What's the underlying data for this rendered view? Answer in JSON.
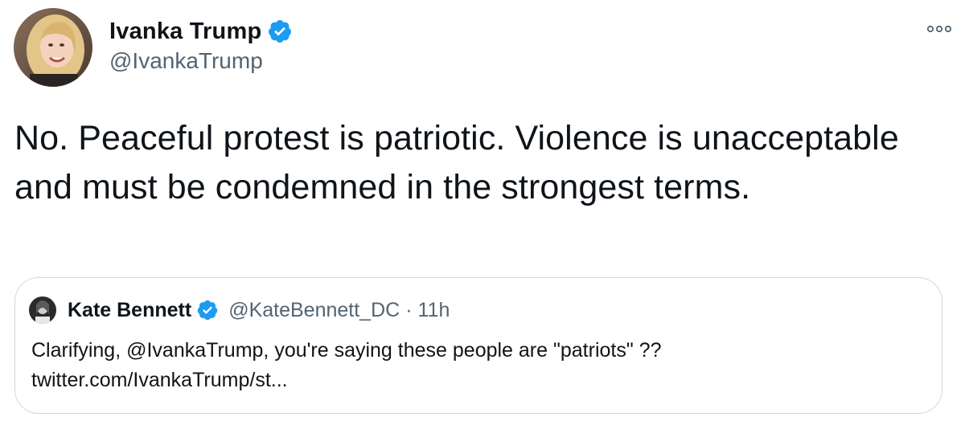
{
  "author": {
    "name": "Ivanka Trump",
    "handle": "@IvankaTrump",
    "verified": true
  },
  "tweet": {
    "text": "No. Peaceful protest is patriotic. Violence is unacceptable and must be condemned in the strongest terms."
  },
  "quoted_tweet": {
    "name": "Kate Bennett",
    "handle": "@KateBennett_DC",
    "separator": "·",
    "time": "11h",
    "text_line1": "Clarifying, @IvankaTrump, you're saying these people are \"patriots\" ??",
    "text_line2": "twitter.com/IvankaTrump/st..."
  },
  "colors": {
    "verified_blue": "#1d9bf0",
    "secondary_text": "#536471",
    "border": "#cfd9de"
  },
  "icons": {
    "verified": "verified-badge-icon",
    "more": "more-options-icon"
  }
}
